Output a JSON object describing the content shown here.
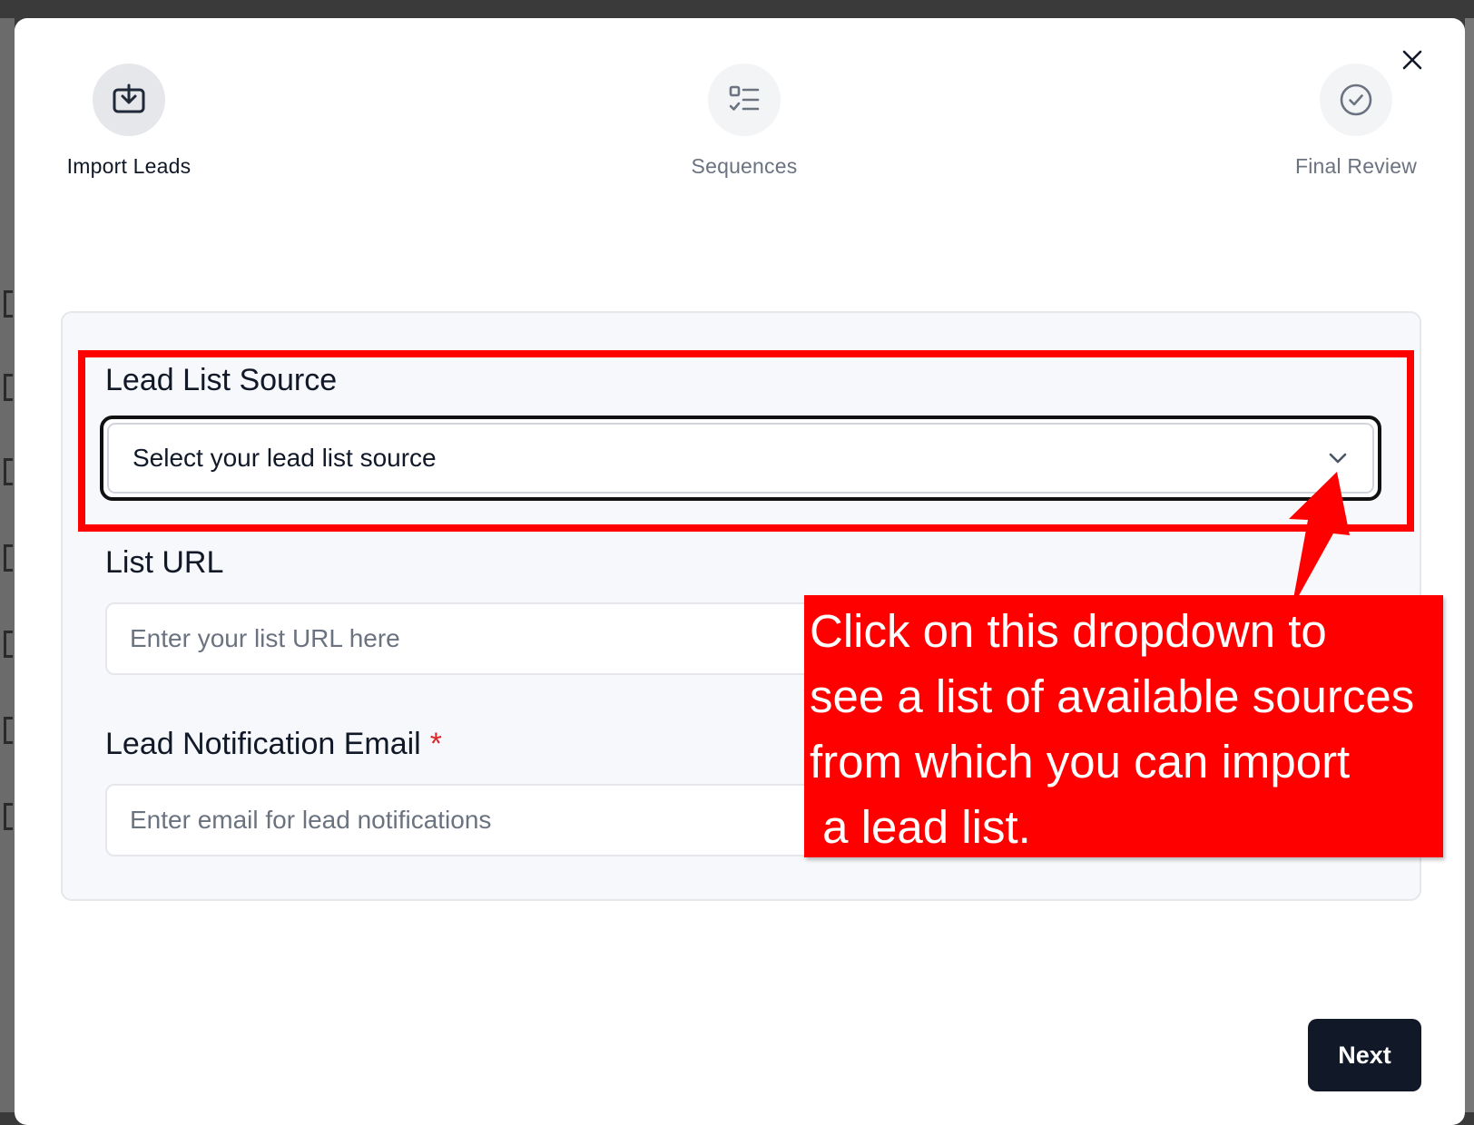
{
  "modal": {
    "close_icon": "close-icon"
  },
  "steps": [
    {
      "label": "Import Leads",
      "icon": "download-icon",
      "state": "active"
    },
    {
      "label": "Sequences",
      "icon": "checklist-icon",
      "state": "inactive"
    },
    {
      "label": "Final Review",
      "icon": "check-circle-icon",
      "state": "inactive"
    }
  ],
  "form": {
    "lead_list_source": {
      "label": "Lead List Source",
      "value": "Select your lead list source",
      "icon": "chevron-down-icon"
    },
    "list_url": {
      "label": "List URL",
      "placeholder": "Enter your list URL here",
      "value": ""
    },
    "notification_email": {
      "label": "Lead Notification Email",
      "required_mark": "*",
      "placeholder": "Enter email for lead notifications",
      "value": ""
    }
  },
  "annotation": {
    "lines": [
      "Click on this dropdown to",
      "see a list of available sources",
      "from which you can import",
      " a lead list."
    ],
    "color": "#ff0000"
  },
  "footer": {
    "next_label": "Next"
  },
  "colors": {
    "primary_button": "#111827",
    "required": "#dc2626",
    "annotation": "#ff0000"
  }
}
